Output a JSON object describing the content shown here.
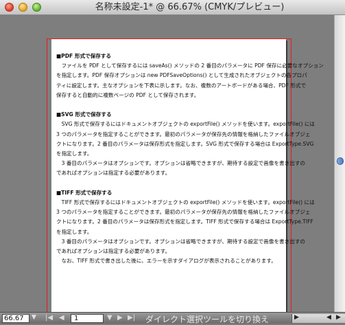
{
  "window": {
    "title": "名称未設定-1* @ 66.67% (CMYK/プレビュー)"
  },
  "document": {
    "lines": [
      {
        "text": "■PDF 形式で保存する",
        "heading": true
      },
      {
        "text": "　ファイルを PDF として保存するには saveAs() メソッドの 2 番目のパラメータに PDF 保存に必要なオプション"
      },
      {
        "text": "を指定します。PDF 保存オプションは new PDFSaveOptions() として生成されたオブジェクトの各プロパ"
      },
      {
        "text": "ティに設定します。主なオプションを下表に示します。なお、複数のアートボードがある場合、PDF 形式で"
      },
      {
        "text": "保存すると自動的に複数ページの PDF として保存されます。"
      },
      {
        "text": ""
      },
      {
        "text": "■SVG 形式で保存する",
        "heading": true
      },
      {
        "text": "　SVG 形式で保存するにはドキュメントオブジェクトの exportFile() メソッドを使います。exportFile() には"
      },
      {
        "text": "3 つのパラメータを指定することができます。最初のパラメータが保存先の情報を格納したファイルオブジェ"
      },
      {
        "text": "クトになります。2 番目のパラメータは保存形式を指定します。SVG 形式で保存する場合は ExportType.SVG"
      },
      {
        "text": "を指定します。"
      },
      {
        "text": "　3 番目のパラメータはオプションです。オプションは省略できますが、期待する設定で画像を書き出すの"
      },
      {
        "text": "であればオプションは指定する必要があります。"
      },
      {
        "text": ""
      },
      {
        "text": "■TIFF 形式で保存する",
        "heading": true
      },
      {
        "text": "　TIFF 形式で保存するにはドキュメントオブジェクトの exportFile() メソッドを使います。exportFile() には"
      },
      {
        "text": "3 つのパラメータを指定することができます。最初のパラメータが保存先の情報を格納したファイルオブジェ"
      },
      {
        "text": "クトになります。2 番目のパラメータは保存形式を指定します。TIFF 形式で保存する場合は ExportType.TIFF"
      },
      {
        "text": "を指定します。"
      },
      {
        "text": "　3 番目のパラメータはオプションです。オプションは省略できますが、期待する設定で画像を書き出すの"
      },
      {
        "text": "であればオプションは指定する必要があります。"
      },
      {
        "text": "　なお、TIFF 形式で書き出した後に、エラーを示すダイアログが表示されることがあります。"
      }
    ]
  },
  "statusbar": {
    "zoom_value": "66.67",
    "page_number": "1",
    "status_text": "ダイレクト選択ツールを切り換え",
    "nav_first": "|◀",
    "nav_prev": "◀",
    "nav_next": "▶",
    "nav_last": "▶|",
    "dropdown_arrow": "▼",
    "status_arrow": "▶"
  },
  "colors": {
    "bleed_guide": "#e01e1e",
    "pasteboard": "#7e7e7e",
    "artboard": "#ffffff"
  }
}
